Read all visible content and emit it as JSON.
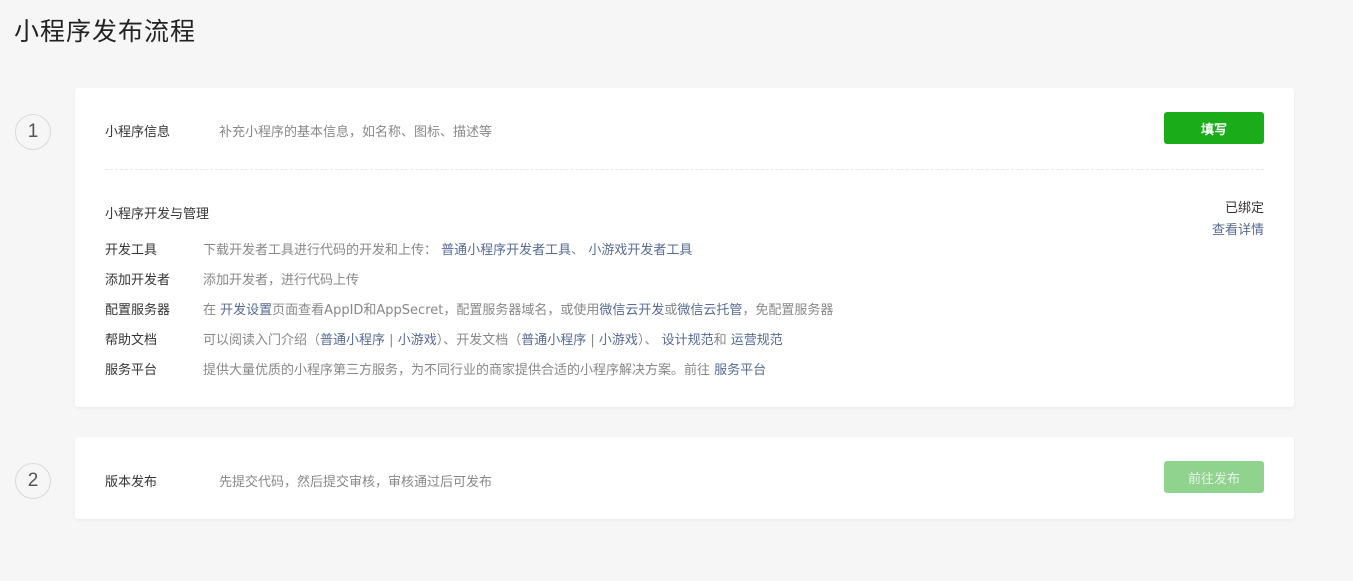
{
  "page": {
    "title": "小程序发布流程"
  },
  "steps": [
    {
      "number": "1",
      "label": "小程序信息",
      "description": "补充小程序的基本信息，如名称、图标、描述等",
      "button": "填写"
    },
    {
      "number": "2",
      "label": "版本发布",
      "description": "先提交代码，然后提交审核，审核通过后可发布",
      "button": "前往发布"
    }
  ],
  "dev": {
    "title": "小程序开发与管理",
    "status": "已绑定",
    "detail_link": "查看详情",
    "rows": {
      "tools": {
        "label": "开发工具",
        "text1": "下载开发者工具进行代码的开发和上传：",
        "link1": "普通小程序开发者工具",
        "text2": "、",
        "link2": "小游戏开发者工具"
      },
      "developers": {
        "label": "添加开发者",
        "text1": "添加开发者，进行代码上传"
      },
      "server": {
        "label": "配置服务器",
        "text1": "在",
        "link1": "开发设置",
        "text2": "页面查看AppID和AppSecret，配置服务器域名，或使用",
        "link2": "微信云开发",
        "text3": "或",
        "link3": "微信云托管",
        "text4": "，免配置服务器"
      },
      "docs": {
        "label": "帮助文档",
        "text1": "可以阅读入门介绍（",
        "link1": "普通小程序",
        "sep1": "|",
        "link2": "小游戏",
        "text2": "）、开发文档（",
        "link3": "普通小程序",
        "sep2": "|",
        "link4": "小游戏",
        "text3": "）、",
        "link5": "设计规范",
        "text4": "和",
        "link6": "运营规范"
      },
      "platform": {
        "label": "服务平台",
        "text1": "提供大量优质的小程序第三方服务，为不同行业的商家提供合适的小程序解决方案。前往",
        "link1": "服务平台"
      }
    }
  },
  "colors": {
    "primary_green": "#1aad19",
    "disabled_green": "#8fd38e",
    "link_blue": "#576b95",
    "muted_text": "#888888",
    "background": "#f6f6f6"
  }
}
